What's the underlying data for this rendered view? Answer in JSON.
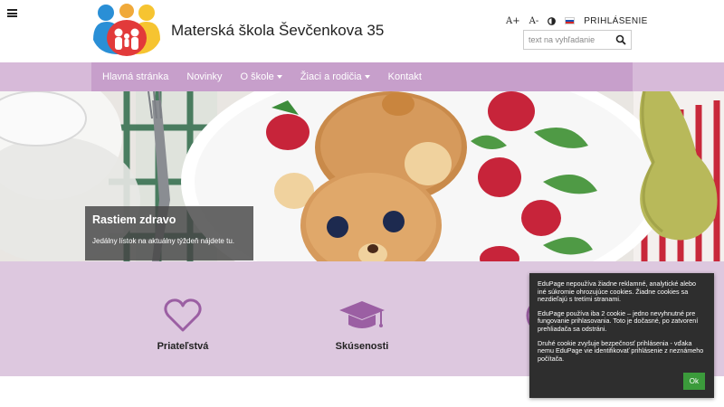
{
  "header": {
    "title": "Materská škola Ševčenkova 35",
    "menu_icon": "hamburger-menu-icon",
    "logo_icon": "family-logo-icon"
  },
  "tools": {
    "font_increase": "A+",
    "font_decrease": "A-",
    "contrast_icon": "contrast-icon",
    "flag_icon": "slovak-flag-icon",
    "login": "PRIHLÁSENIE"
  },
  "search": {
    "placeholder": "text na vyhľadanie",
    "icon": "search-icon"
  },
  "nav": {
    "items": [
      {
        "label": "Hlavná stránka",
        "dropdown": false
      },
      {
        "label": "Novinky",
        "dropdown": false
      },
      {
        "label": "O škole",
        "dropdown": true
      },
      {
        "label": "Žiaci a rodičia",
        "dropdown": true
      },
      {
        "label": "Kontakt",
        "dropdown": false
      }
    ]
  },
  "hero": {
    "title": "Rastiem zdravo",
    "text": "Jedálny lístok na aktuálny týždeň nájdete tu."
  },
  "features": [
    {
      "label": "Priateľstvá",
      "icon": "heart-icon"
    },
    {
      "label": "Skúsenosti",
      "icon": "graduation-cap-icon"
    },
    {
      "label": "",
      "icon": "circle-icon"
    }
  ],
  "cookie": {
    "p1": "EduPage nepoužíva žiadne reklamné, analytické alebo iné súkromie ohrozujúce cookies. Žiadne cookies sa nezdieľajú s tretími stranami.",
    "p2": "EduPage používa iba 2 cookie – jedno nevyhnutné pre fungovanie prihlasovania. Toto je dočasné, po zatvorení prehliadača sa odstráni.",
    "p3": "Druhé cookie zvyšuje bezpečnosť prihlásenia - vďaka nemu EduPage vie identifikovať prihlásenie z neznámeho počítača.",
    "ok": "Ok"
  },
  "colors": {
    "nav_bg": "#c79fcb",
    "nav_outer": "#d7bad9",
    "feature_bg": "#ddc8df",
    "accent_purple": "#9b5fa3",
    "ok_green": "#3b9b3b"
  }
}
